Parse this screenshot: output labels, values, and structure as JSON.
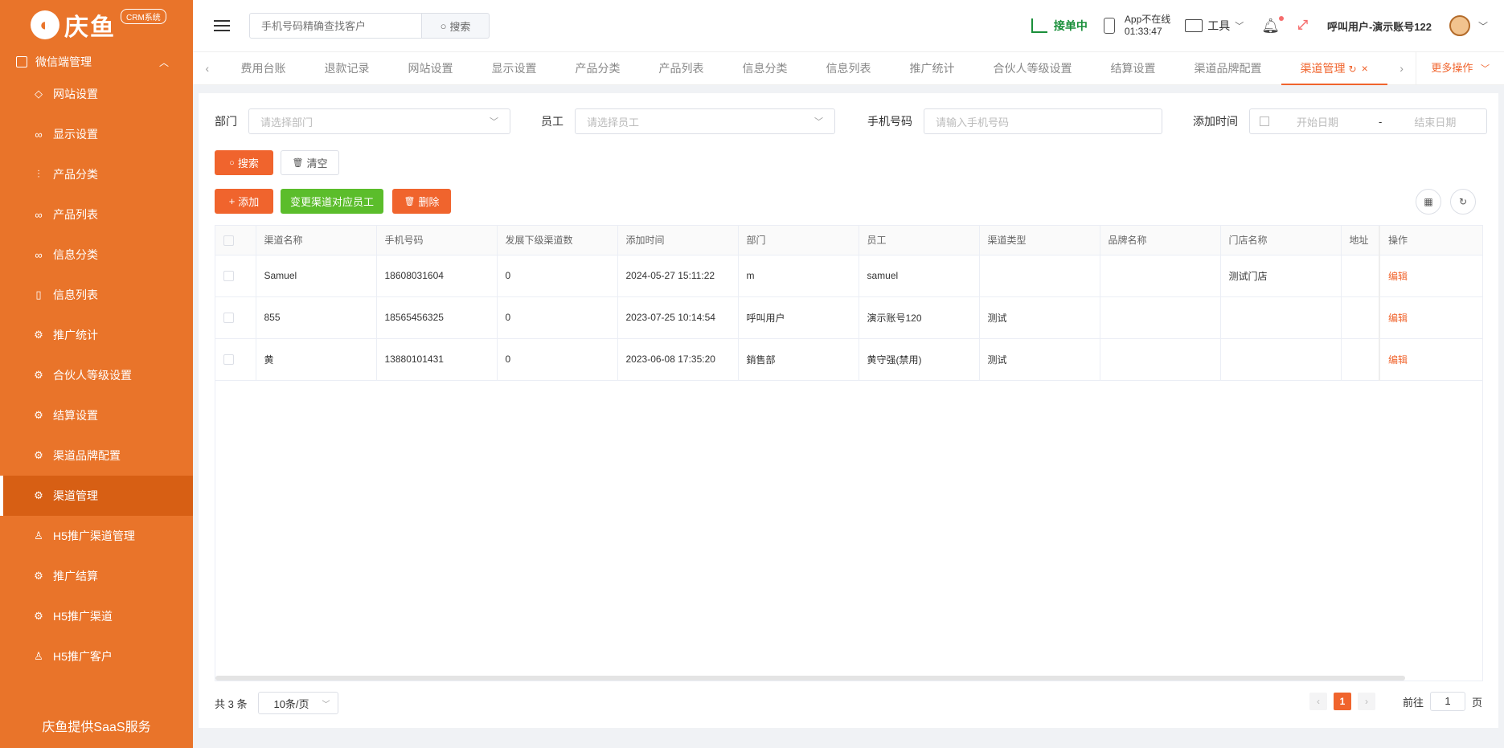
{
  "brand": {
    "logo_text": "庆鱼",
    "badge": "CRM系统"
  },
  "sidebar": {
    "group_label": "微信端管理",
    "items": [
      {
        "label": "网站设置",
        "icon": "tag-icon"
      },
      {
        "label": "显示设置",
        "icon": "glasses-icon"
      },
      {
        "label": "产品分类",
        "icon": "sliders-icon"
      },
      {
        "label": "产品列表",
        "icon": "glasses-icon"
      },
      {
        "label": "信息分类",
        "icon": "glasses-icon"
      },
      {
        "label": "信息列表",
        "icon": "book-icon"
      },
      {
        "label": "推广统计",
        "icon": "gear-icon"
      },
      {
        "label": "合伙人等级设置",
        "icon": "gear-icon"
      },
      {
        "label": "结算设置",
        "icon": "gear-icon"
      },
      {
        "label": "渠道品牌配置",
        "icon": "gear-icon"
      },
      {
        "label": "渠道管理",
        "icon": "gear-icon"
      },
      {
        "label": "H5推广渠道管理",
        "icon": "user-icon"
      },
      {
        "label": "推广结算",
        "icon": "gear-icon"
      },
      {
        "label": "H5推广渠道",
        "icon": "gear-icon"
      },
      {
        "label": "H5推广客户",
        "icon": "users-icon"
      }
    ],
    "footer": "庆鱼提供SaaS服务"
  },
  "header": {
    "search_placeholder": "手机号码精确查找客户",
    "search_button": "搜索",
    "accept_label": "接单中",
    "app_status": "App不在线",
    "app_time": "01:33:47",
    "tools_label": "工具",
    "user_name": "呼叫用户-演示账号122"
  },
  "tabs": [
    {
      "label": "费用台账"
    },
    {
      "label": "退款记录"
    },
    {
      "label": "网站设置"
    },
    {
      "label": "显示设置"
    },
    {
      "label": "产品分类"
    },
    {
      "label": "产品列表"
    },
    {
      "label": "信息分类"
    },
    {
      "label": "信息列表"
    },
    {
      "label": "推广统计"
    },
    {
      "label": "合伙人等级设置"
    },
    {
      "label": "结算设置"
    },
    {
      "label": "渠道品牌配置"
    },
    {
      "label": "渠道管理"
    }
  ],
  "more_ops": "更多操作",
  "filters": {
    "dept_label": "部门",
    "dept_placeholder": "请选择部门",
    "staff_label": "员工",
    "staff_placeholder": "请选择员工",
    "phone_label": "手机号码",
    "phone_placeholder": "请输入手机号码",
    "time_label": "添加时间",
    "start_placeholder": "开始日期",
    "range_sep": "-",
    "end_placeholder": "结束日期"
  },
  "actions": {
    "search": "搜索",
    "clear": "清空",
    "add": "添加",
    "change_staff": "变更渠道对应员工",
    "delete": "删除"
  },
  "table": {
    "headers": [
      "渠道名称",
      "手机号码",
      "发展下级渠道数",
      "添加时间",
      "部门",
      "员工",
      "渠道类型",
      "品牌名称",
      "门店名称",
      "地址",
      "操作"
    ],
    "rows": [
      {
        "name": "Samuel",
        "phone": "18608031604",
        "sub_count": "0",
        "added": "2024-05-27 15:11:22",
        "dept": "m",
        "staff": "samuel",
        "type": "",
        "brand": "",
        "store": "测试门店",
        "address": "",
        "op": "编辑"
      },
      {
        "name": "855",
        "phone": "18565456325",
        "sub_count": "0",
        "added": "2023-07-25 10:14:54",
        "dept": "呼叫用户",
        "staff": "演示账号120",
        "type": "测试",
        "brand": "",
        "store": "",
        "address": "",
        "op": "编辑"
      },
      {
        "name": "黄",
        "phone": "13880101431",
        "sub_count": "0",
        "added": "2023-06-08 17:35:20",
        "dept": "銷售部",
        "staff": "黄守强(禁用)",
        "type": "测试",
        "brand": "",
        "store": "",
        "address": "",
        "op": "编辑"
      }
    ]
  },
  "pagination": {
    "total": "共 3 条",
    "page_size": "10条/页",
    "current": "1",
    "goto_prefix": "前往",
    "goto_value": "1",
    "goto_suffix": "页"
  }
}
